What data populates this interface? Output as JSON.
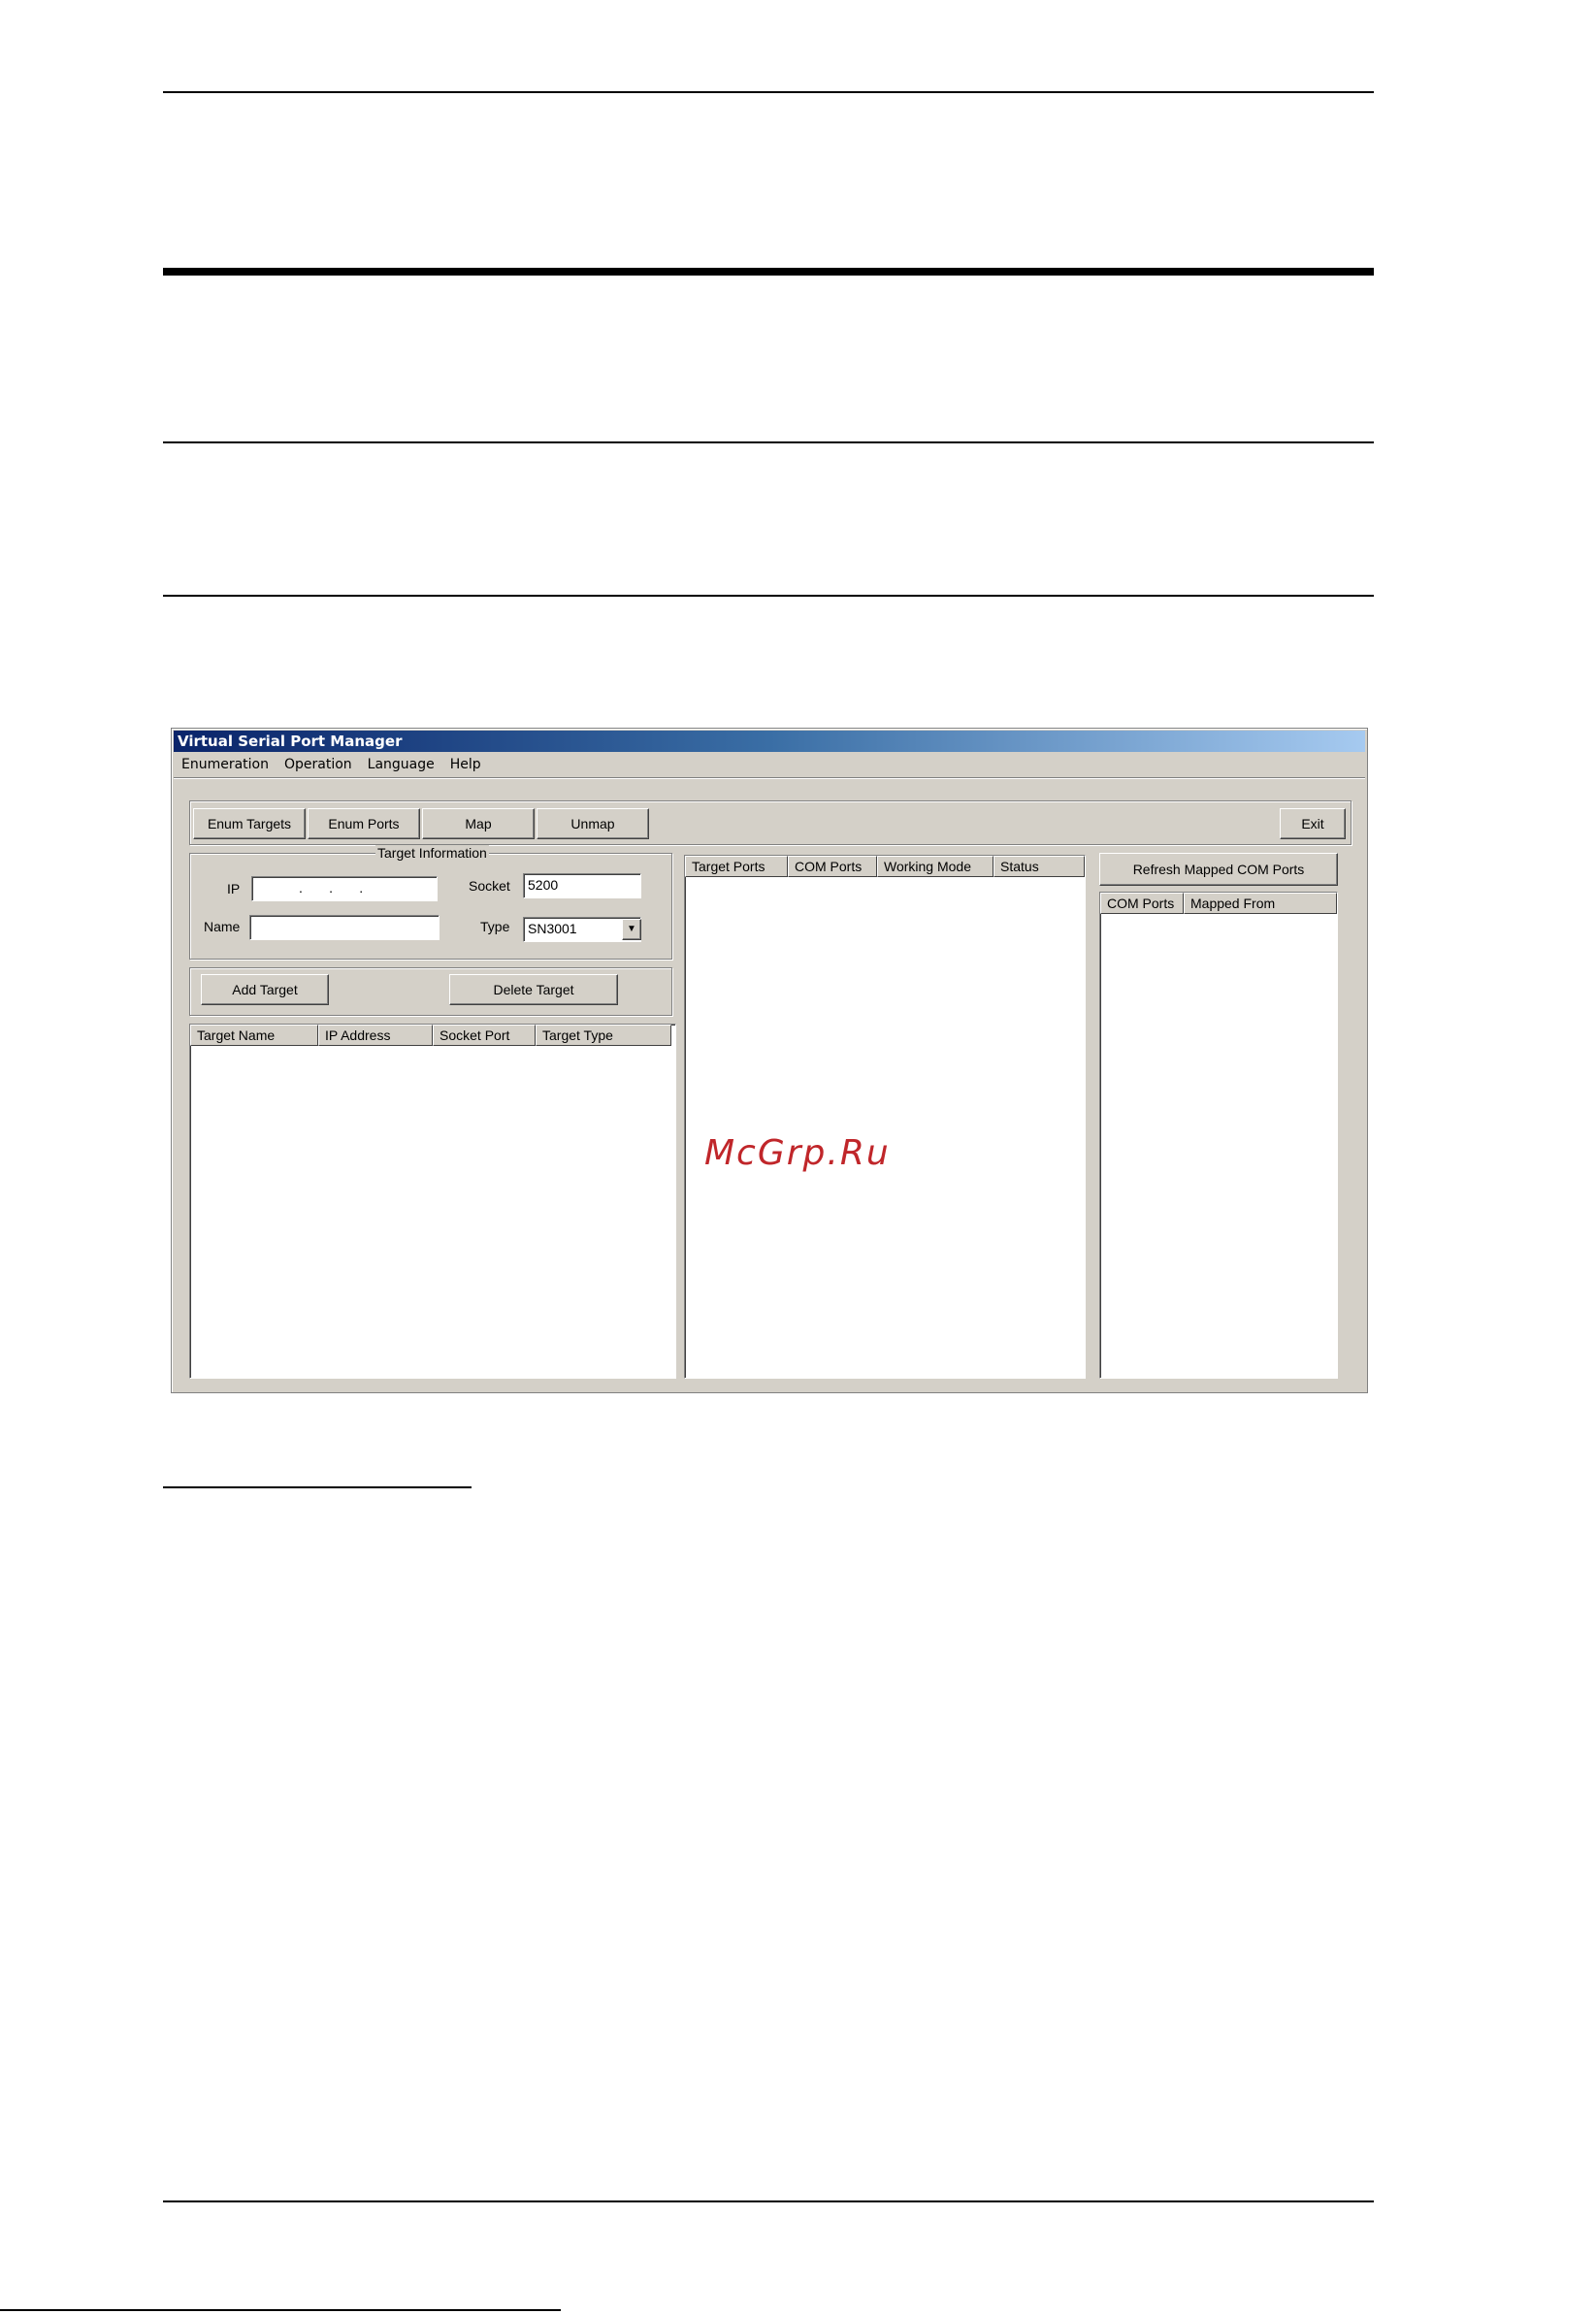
{
  "window": {
    "title": "Virtual Serial Port Manager",
    "menu": [
      "Enumeration",
      "Operation",
      "Language",
      "Help"
    ]
  },
  "toolbar": {
    "enum_targets": "Enum Targets",
    "enum_ports": "Enum Ports",
    "map": "Map",
    "unmap": "Unmap",
    "exit": "Exit"
  },
  "target_info": {
    "group_label": "Target Information",
    "ip_label": "IP",
    "ip_value": ".       .       .",
    "socket_label": "Socket",
    "socket_value": "5200",
    "name_label": "Name",
    "name_value": "",
    "type_label": "Type",
    "type_value": "SN3001",
    "dropdown_arrow": "▼"
  },
  "target_actions": {
    "add": "Add Target",
    "delete": "Delete Target"
  },
  "targets_table": {
    "columns": [
      "Target Name",
      "IP Address",
      "Socket Port",
      "Target Type"
    ]
  },
  "ports_table": {
    "columns": [
      "Target Ports",
      "COM Ports",
      "Working Mode",
      "Status"
    ]
  },
  "mapped": {
    "refresh": "Refresh Mapped COM Ports",
    "columns": [
      "COM Ports",
      "Mapped From"
    ]
  },
  "watermark": "McGrp.Ru"
}
